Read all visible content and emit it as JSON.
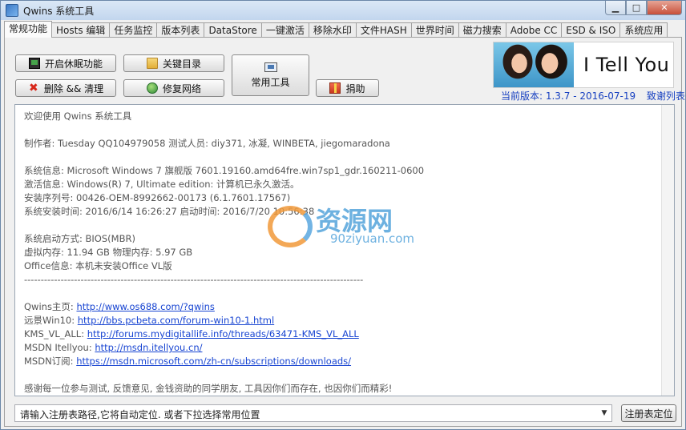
{
  "window": {
    "title": "Qwins 系统工具"
  },
  "tabs": [
    {
      "label": "常规功能",
      "active": true
    },
    {
      "label": "Hosts 编辑"
    },
    {
      "label": "任务监控"
    },
    {
      "label": "版本列表"
    },
    {
      "label": "DataStore"
    },
    {
      "label": "一键激活"
    },
    {
      "label": "移除水印"
    },
    {
      "label": "文件HASH"
    },
    {
      "label": "世界时间"
    },
    {
      "label": "磁力搜索"
    },
    {
      "label": "Adobe CC"
    },
    {
      "label": "ESD & ISO"
    },
    {
      "label": "系统应用"
    }
  ],
  "buttons": {
    "hibernate": "开启休眠功能",
    "key_dirs": "关键目录",
    "common_tools": "常用工具",
    "delete_clean": "删除 && 清理",
    "repair_network": "修复网络",
    "donate": "捐助"
  },
  "banner": {
    "text": "I Tell You"
  },
  "version": {
    "label": "当前版本: 1.3.7 - 2016-07-19",
    "thanks": "致谢列表"
  },
  "info": {
    "welcome": "欢迎使用 Qwins 系统工具",
    "author": "制作者: Tuesday QQ104979058 测试人员: diy371, 冰凝, WINBETA, jiegomaradona",
    "sys_info": "系统信息: Microsoft Windows 7 旗舰版  7601.19160.amd64fre.win7sp1_gdr.160211-0600",
    "activation": "激活信息: Windows(R) 7, Ultimate edition:  计算机已永久激活。",
    "serial": "安装序列号: 00426-OEM-8992662-00173 (6.1.7601.17567)",
    "install_time": "系统安装时间: 2016/6/14 16:26:27 启动时间: 2016/7/20 10:56:38",
    "boot_mode": "系统启动方式: BIOS(MBR)",
    "memory": "虚拟内存: 11.94 GB 物理内存: 5.97 GB",
    "office": "Office信息: 本机未安装Office VL版",
    "divider": "------------------------------------------------------------------------------------------------------",
    "links": [
      {
        "label": "Qwins主页: ",
        "url": "http://www.os688.com/?qwins"
      },
      {
        "label": "远景Win10: ",
        "url": "http://bbs.pcbeta.com/forum-win10-1.html"
      },
      {
        "label": "KMS_VL_ALL: ",
        "url": "http://forums.mydigitallife.info/threads/63471-KMS_VL_ALL"
      },
      {
        "label": "MSDN Itellyou: ",
        "url": "http://msdn.itellyou.cn/"
      },
      {
        "label": "MSDN订阅: ",
        "url": "https://msdn.microsoft.com/zh-cn/subscriptions/downloads/"
      }
    ],
    "thanks_msg": "感谢每一位参与测试, 反馈意见, 金钱资助的同学朋友, 工具因你们而存在, 也因你们而精彩!"
  },
  "watermark": {
    "big": "资源网",
    "small": "90ziyuan.com"
  },
  "registry": {
    "placeholder": "请输入注册表路径,它将自动定位. 或者下拉选择常用位置",
    "locate_button": "注册表定位"
  }
}
